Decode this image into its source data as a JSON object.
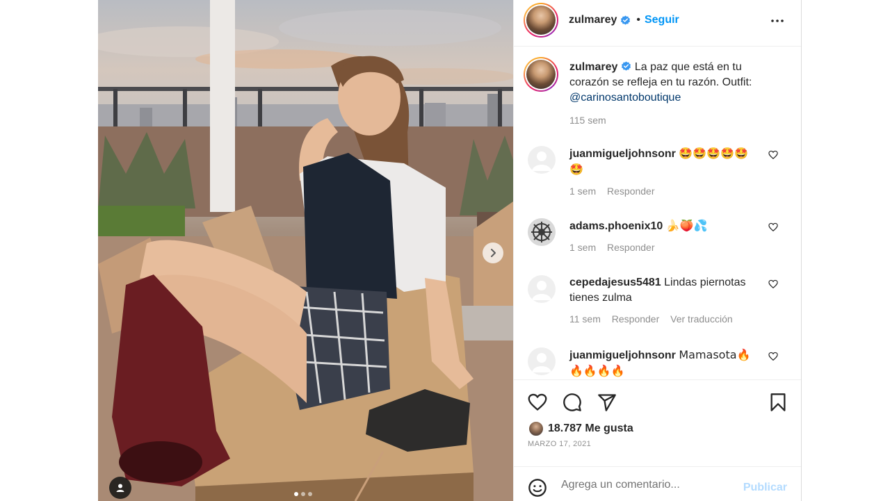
{
  "post": {
    "username": "zulmarey",
    "follow_label": "Seguir",
    "separator": "•",
    "caption_text": "La paz que está en tu corazón se refleja en tu razón. Outfit: ",
    "caption_mention": "@carinosantoboutique",
    "caption_time": "115 sem"
  },
  "comments": [
    {
      "user": "juanmigueljohnsonr",
      "text": "🤩🤩🤩🤩🤩🤩",
      "time": "1 sem",
      "reply": "Responder",
      "translate": ""
    },
    {
      "user": "adams.phoenix10",
      "text": "🍌🍑💦",
      "time": "1 sem",
      "reply": "Responder",
      "translate": ""
    },
    {
      "user": "cepedajesus5481",
      "text": "Lindas piernotas tienes zulma",
      "time": "11 sem",
      "reply": "Responder",
      "translate": "Ver traducción"
    },
    {
      "user": "juanmigueljohnsonr",
      "text": "Mamasota🔥🔥🔥🔥🔥",
      "time": "",
      "reply": "",
      "translate": ""
    }
  ],
  "stats": {
    "likes": "18.787 Me gusta",
    "date": "MARZO 17, 2021"
  },
  "comment_box": {
    "placeholder": "Agrega un comentario...",
    "post_label": "Publicar"
  },
  "carousel": {
    "total": 3,
    "current": 1
  },
  "colors": {
    "accent": "#0095f6",
    "text": "#262626",
    "muted": "#8e8e8e",
    "verified": "#3897f0"
  },
  "icons": [
    "more-options-icon",
    "verified-badge-icon",
    "heart-icon",
    "comment-icon",
    "share-icon",
    "bookmark-icon",
    "emoji-icon",
    "next-arrow-icon",
    "user-tag-icon"
  ]
}
